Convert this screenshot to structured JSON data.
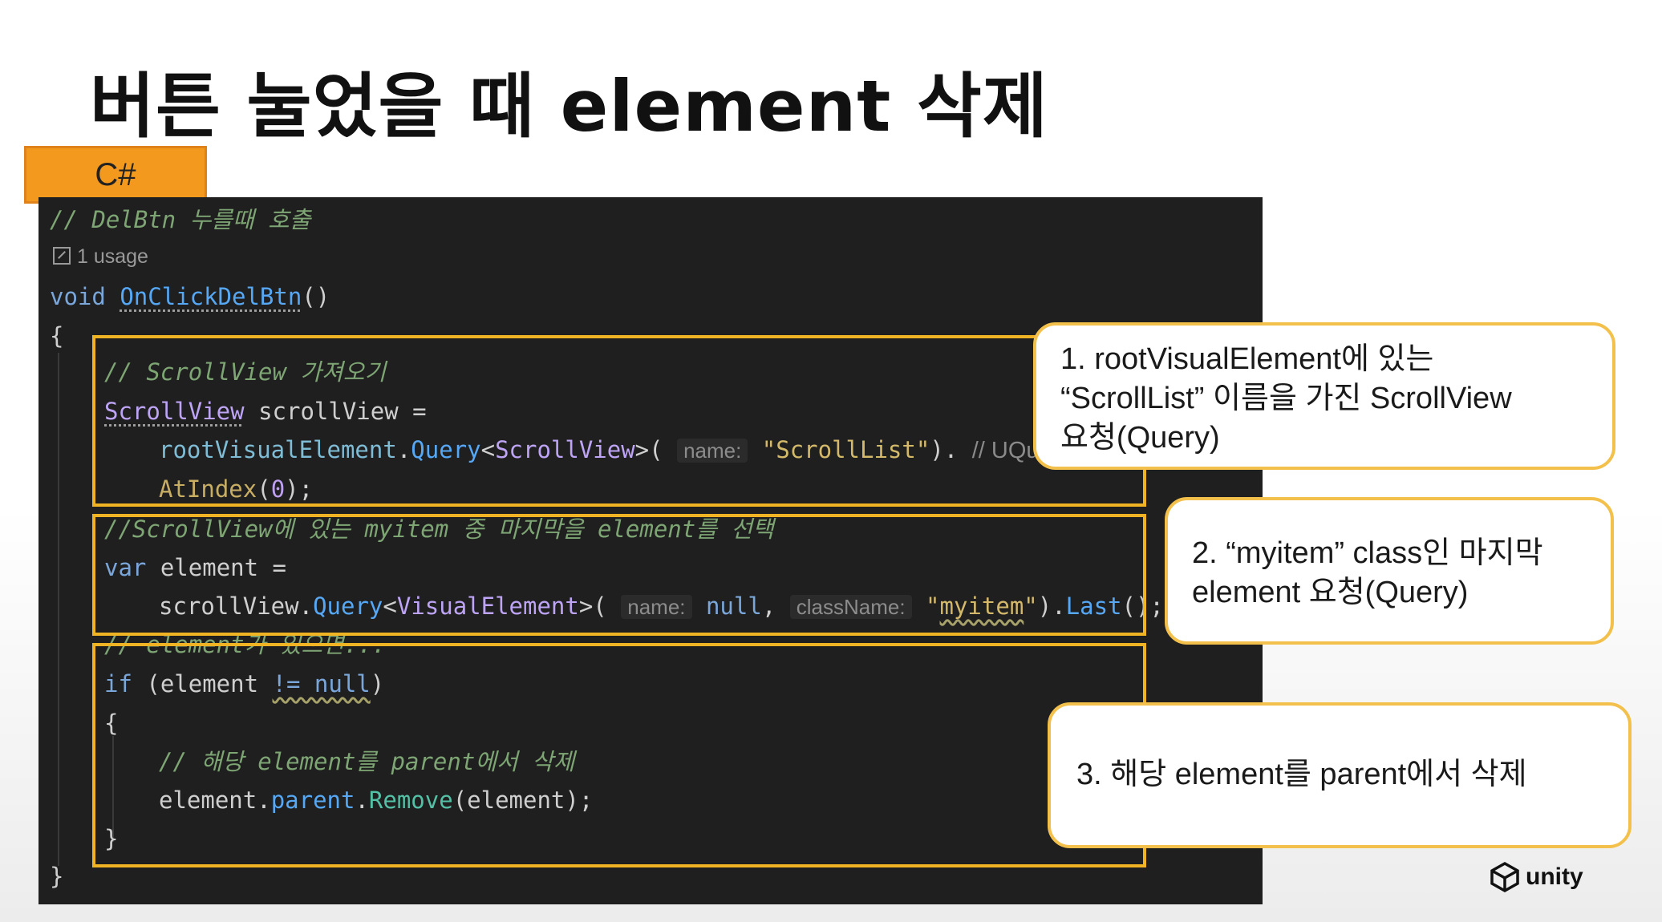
{
  "title": "버튼 눌었을 때 element 삭제",
  "lang_tab": "C#",
  "code": {
    "line1_comment": "// DelBtn 누를때 호출",
    "usage": "1 usage",
    "line2_void": "void ",
    "line2_method": "OnClickDelBtn",
    "line2_parens": "()",
    "open_brace": "{",
    "c1": "// ScrollView 가져오기",
    "l3_type": "ScrollView",
    "l3_rest": " scrollView =",
    "l4_obj": "rootVisualElement",
    "l4_dot": ".",
    "l4_query": "Query",
    "l4_lt": "<",
    "l4_type": "ScrollView",
    "l4_gt": ">(",
    "l4_hint": "name:",
    "l4_str": "\"ScrollList\"",
    "l4_end": ").",
    "l4_trail": "// UQuery",
    "l5_fn": "AtIndex",
    "l5_open": "(",
    "l5_num": "0",
    "l5_close": ");",
    "c2": "//ScrollView에 있는 myitem 중 마지막을 element를 선택",
    "l6_kw": "var",
    "l6_rest": " element =",
    "l7_obj": "scrollView",
    "l7_dot": ".",
    "l7_query": "Query",
    "l7_lt": "<",
    "l7_type": "VisualElement",
    "l7_gt": ">(",
    "l7_hint1": "name:",
    "l7_null": "null",
    "l7_comma": ",",
    "l7_hint2": "className:",
    "l7_q1": "\"",
    "l7_str": "myitem",
    "l7_q2": "\"",
    "l7_end": ").",
    "l7_last": "Last",
    "l7_close": "();",
    "c3": "// element가 있으면...",
    "l8_kw": "if",
    "l8_open": " (element ",
    "l8_op": "!= null",
    "l8_close": ")",
    "inner_open": "{",
    "c4": "// 해당 element를 parent에서 삭제",
    "l9_obj": "element",
    "l9_dot1": ".",
    "l9_parent": "parent",
    "l9_dot2": ".",
    "l9_remove": "Remove",
    "l9_args": "(element);",
    "inner_close": "}",
    "close_brace": "}"
  },
  "callouts": [
    {
      "text": "1. rootVisualElement에 있는\n“ScrollList” 이름을 가진 ScrollView\n요청(Query)"
    },
    {
      "text": "2. “myitem” class인 마지막\nelement 요청(Query)"
    },
    {
      "text": "3. 해당 element를 parent에서 삭제"
    }
  ],
  "logo": {
    "text": "unity",
    "icon": "unity-cube-icon"
  },
  "colors": {
    "tab": "#f39a1e",
    "highlight": "#f0b323",
    "callout_border": "#f3c14b",
    "code_bg": "#1f1f1f"
  }
}
